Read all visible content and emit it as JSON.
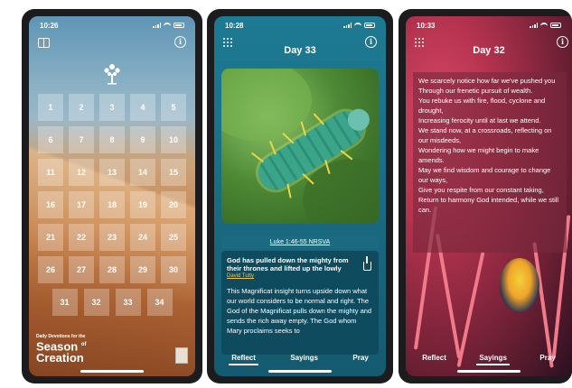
{
  "phone1": {
    "time": "10:26",
    "days_rows": [
      [
        "1",
        "2",
        "3",
        "4",
        "5"
      ],
      [
        "6",
        "7",
        "8",
        "9",
        "10"
      ],
      [
        "11",
        "12",
        "13",
        "14",
        "15"
      ],
      [
        "16",
        "17",
        "18",
        "19",
        "20"
      ],
      [
        "21",
        "22",
        "23",
        "24",
        "25"
      ],
      [
        "26",
        "27",
        "28",
        "29",
        "30"
      ]
    ],
    "last_row": [
      "31",
      "32",
      "33",
      "34"
    ],
    "brand_small": "Daily Devotions for the",
    "brand_line1": "Season",
    "brand_of": "of",
    "brand_line2": "Creation"
  },
  "phone2": {
    "time": "10:28",
    "title": "Day 33",
    "reference": "Luke 1:46-55 NRSVA",
    "headline": "God has pulled down the mighty from their thrones and lifted up the lowly",
    "author": "David Tutty",
    "body": "This Magnificat insight turns upside down what our world considers to be normal and right. The God of the Magnificat pulls down the mighty and sends the rich away empty. The God whom Mary proclaims seeks to",
    "tabs": [
      "Reflect",
      "Sayings",
      "Pray"
    ]
  },
  "phone3": {
    "time": "10:33",
    "title": "Day 32",
    "poem": [
      "We scarcely notice how far we've pushed you",
      "Through our frenetic pursuit of wealth.",
      "You rebuke us with fire, flood, cyclone and drought,",
      "Increasing ferocity until at last we attend.",
      "We stand now, at a crossroads, reflecting on our misdeeds,",
      "Wondering how we might begin to make amends.",
      "May we find wisdom and courage to change our ways,",
      "Give you respite from our constant taking,",
      "Return to harmony God intended, while we still can."
    ],
    "tabs": [
      "Reflect",
      "Sayings",
      "Pray"
    ]
  }
}
